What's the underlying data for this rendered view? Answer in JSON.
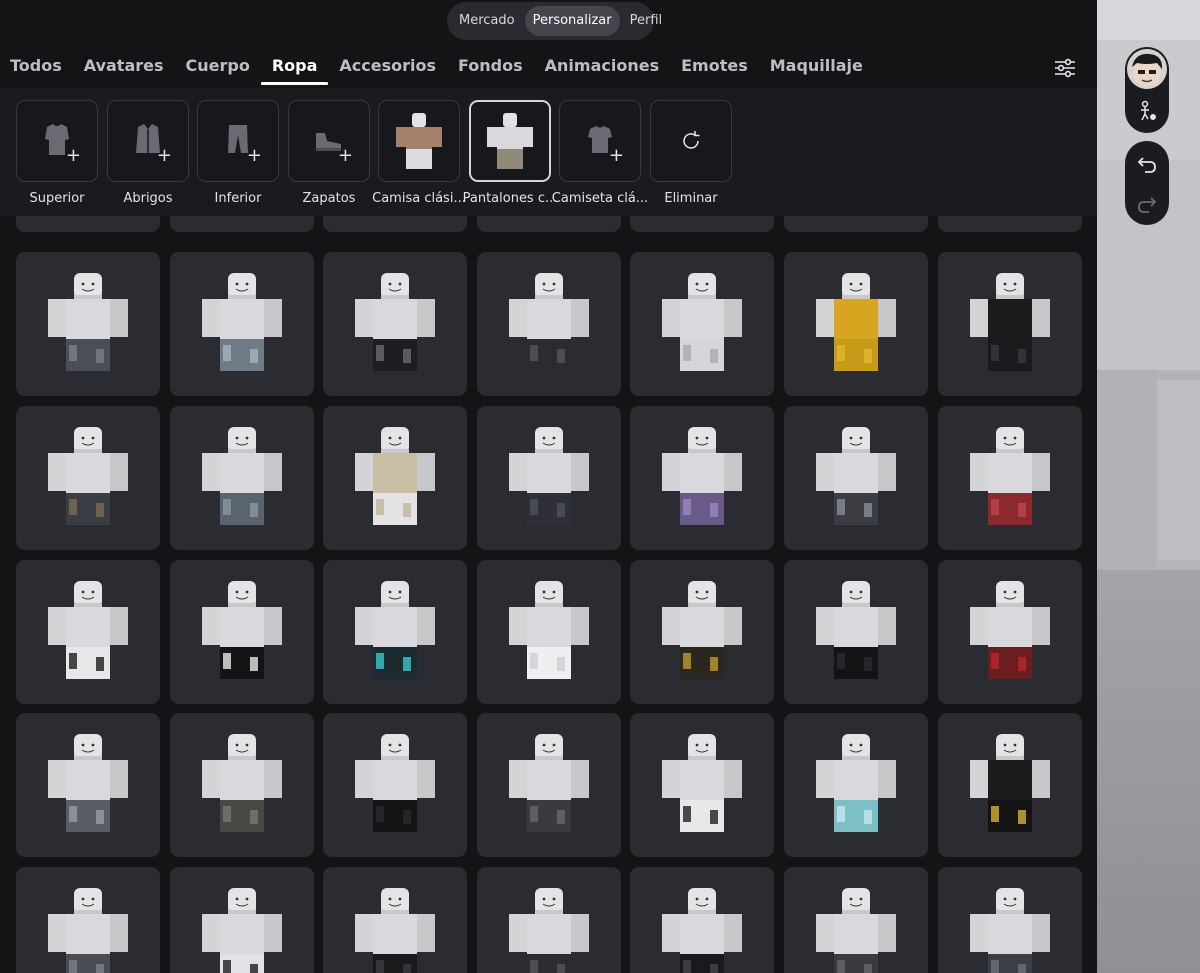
{
  "switcher": {
    "items": [
      "Mercado",
      "Personalizar",
      "Perfil"
    ],
    "active": "Personalizar"
  },
  "tabs": {
    "items": [
      "Todos",
      "Avatares",
      "Cuerpo",
      "Ropa",
      "Accesorios",
      "Fondos",
      "Animaciones",
      "Emotes",
      "Maquillaje"
    ],
    "active": "Ropa"
  },
  "equipped": [
    {
      "label": "Superior",
      "icon": "shirt-icon",
      "state": "empty"
    },
    {
      "label": "Abrigos",
      "icon": "jacket-icon",
      "state": "empty"
    },
    {
      "label": "Inferior",
      "icon": "pants-icon",
      "state": "empty"
    },
    {
      "label": "Zapatos",
      "icon": "shoe-icon",
      "state": "empty"
    },
    {
      "label": "Camisa clási...",
      "icon": "classic-shirt-thumb",
      "state": "equipped"
    },
    {
      "label": "Pantalones c...",
      "icon": "classic-pants-thumb",
      "state": "selected"
    },
    {
      "label": "Camiseta clá...",
      "icon": "tshirt-icon",
      "state": "empty"
    },
    {
      "label": "Eliminar",
      "icon": "refresh-icon",
      "state": "action"
    }
  ],
  "grid_rows": [
    [
      {
        "pants": "#4a4e55",
        "accent": "#7a7f88",
        "shirt": "#d9d9dd"
      },
      {
        "pants": "#6e7c88",
        "accent": "#a8b3bd",
        "shirt": "#d9d9dd"
      },
      {
        "pants": "#1e1e22",
        "accent": "#6a6a70",
        "shirt": "#d9d9dd"
      },
      {
        "pants": "#2a2c30",
        "accent": "#55585e",
        "shirt": "#d9d9dd"
      },
      {
        "pants": "#d6d6da",
        "accent": "#a9a9ae",
        "shirt": "#d9d9dd"
      },
      {
        "pants": "#c79a1a",
        "accent": "#e2b82b",
        "shirt": "#d7a51f"
      },
      {
        "pants": "#1a1a1c",
        "accent": "#3a3a3e",
        "shirt": "#1c1c1f"
      }
    ],
    [
      {
        "pants": "#3a3d44",
        "accent": "#7b6a55",
        "shirt": "#d9d9dd"
      },
      {
        "pants": "#5a6470",
        "accent": "#8a96a3",
        "shirt": "#d9d9dd"
      },
      {
        "pants": "#e3e3e6",
        "accent": "#bfb39a",
        "shirt": "#c9bda3"
      },
      {
        "pants": "#2e3035",
        "accent": "#4f525a",
        "shirt": "#d9d9dd"
      },
      {
        "pants": "#6a5a8a",
        "accent": "#9a88c0",
        "shirt": "#d9d9dd"
      },
      {
        "pants": "#3b3d42",
        "accent": "#8a8d94",
        "shirt": "#d9d9dd"
      },
      {
        "pants": "#8a2a2e",
        "accent": "#c0444a",
        "shirt": "#d9d9dd"
      }
    ],
    [
      {
        "pants": "#e8e8ea",
        "accent": "#1d1d20",
        "shirt": "#d9d9dd"
      },
      {
        "pants": "#141416",
        "accent": "#e6e6e8",
        "shirt": "#d9d9dd"
      },
      {
        "pants": "#1d2a30",
        "accent": "#3bc7c9",
        "shirt": "#d9d9dd"
      },
      {
        "pants": "#efeff1",
        "accent": "#d0d0d4",
        "shirt": "#d9d9dd"
      },
      {
        "pants": "#2a2620",
        "accent": "#c19a2a",
        "shirt": "#d9d9dd"
      },
      {
        "pants": "#141416",
        "accent": "#2b2b2f",
        "shirt": "#d9d9dd"
      },
      {
        "pants": "#6a1e22",
        "accent": "#b9262e",
        "shirt": "#d9d9dd"
      }
    ],
    [
      {
        "pants": "#5a5d63",
        "accent": "#9a9ca2",
        "shirt": "#d9d9dd"
      },
      {
        "pants": "#4a4844",
        "accent": "#7a776f",
        "shirt": "#d9d9dd"
      },
      {
        "pants": "#141416",
        "accent": "#2a2a2e",
        "shirt": "#d9d9dd"
      },
      {
        "pants": "#3a3b3f",
        "accent": "#68696e",
        "shirt": "#d9d9dd"
      },
      {
        "pants": "#e8e8ea",
        "accent": "#1f1f23",
        "shirt": "#d9d9dd"
      },
      {
        "pants": "#7cbfc6",
        "accent": "#c8e6ea",
        "shirt": "#d9d9dd"
      },
      {
        "pants": "#141414",
        "accent": "#d6b12a",
        "shirt": "#1c1c1f"
      }
    ],
    [
      {
        "pants": "#4a4d53",
        "accent": "#7e8188",
        "shirt": "#d9d9dd"
      },
      {
        "pants": "#e2e2e5",
        "accent": "#1e1e22",
        "shirt": "#d9d9dd"
      },
      {
        "pants": "#1a1a1d",
        "accent": "#3c3c41",
        "shirt": "#d9d9dd"
      },
      {
        "pants": "#2c2d31",
        "accent": "#55565c",
        "shirt": "#d9d9dd"
      },
      {
        "pants": "#1a1a1d",
        "accent": "#45464c",
        "shirt": "#d9d9dd"
      },
      {
        "pants": "#3a3b40",
        "accent": "#66676d",
        "shirt": "#d9d9dd"
      },
      {
        "pants": "#3a3e46",
        "accent": "#6c7079",
        "shirt": "#d9d9dd"
      }
    ]
  ],
  "side_controls": {
    "avatar": "avatar-headshot",
    "buttons": [
      "avatar-settings-icon",
      "undo-icon",
      "redo-icon"
    ]
  },
  "colors": {
    "background": "#141417",
    "strip": "#1a1b1f",
    "card": "#2b2c31",
    "accent_white": "#ffffff"
  }
}
